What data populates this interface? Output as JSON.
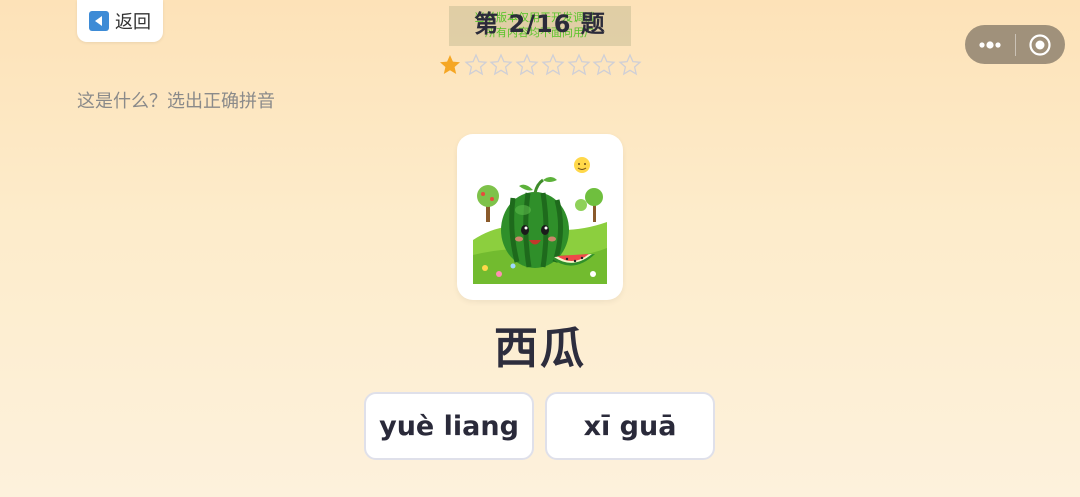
{
  "header": {
    "back_label": "返回",
    "counter": "第 2/16 题",
    "dev_notice_line1": "当前版本仅用于开发调试，",
    "dev_notice_line2": "所有内容均不面向用户"
  },
  "capsule": {
    "more_icon": "more-dots-icon",
    "close_icon": "target-close-icon"
  },
  "progress": {
    "total_stars": 8,
    "filled_stars": 1,
    "filled_color": "#f5a623",
    "empty_color": "#cfcfd6"
  },
  "question": {
    "prompt": "这是什么？选出正确拼音",
    "image_icon": "watermelon-illustration",
    "word": "西瓜"
  },
  "options": [
    {
      "label": "yuè liang"
    },
    {
      "label": "xī guā"
    }
  ]
}
